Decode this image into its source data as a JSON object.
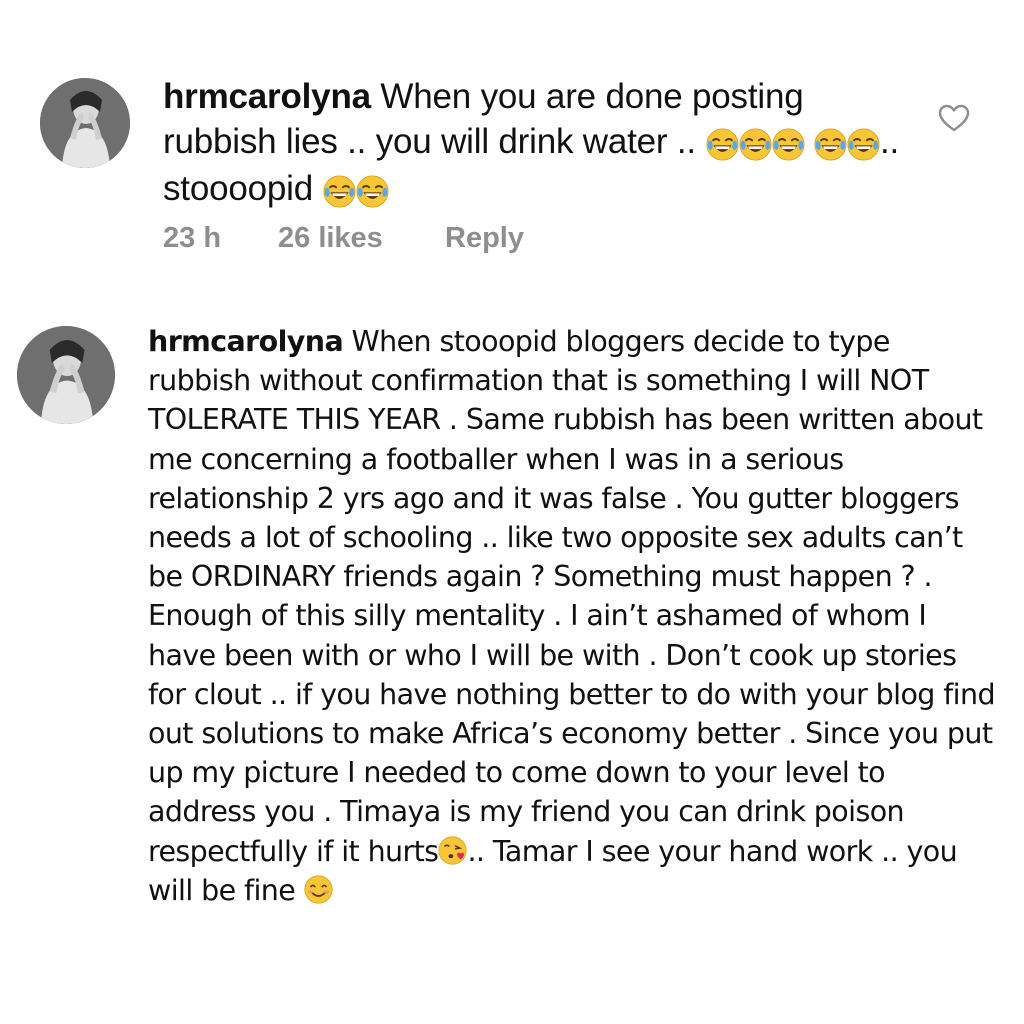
{
  "comments": [
    {
      "username": "hrmcarolyna",
      "text_part1": "When you are done posting rubbish lies .. you will drink water ..",
      "text_part2": ".. stoooopid",
      "emojis_after_part1": [
        "face-with-tears-of-joy",
        "face-with-tears-of-joy",
        "face-with-tears-of-joy"
      ],
      "emojis_before_part2": [
        "face-with-tears-of-joy",
        "face-with-tears-of-joy"
      ],
      "emojis_after_part2": [
        "face-with-tears-of-joy",
        "face-with-tears-of-joy"
      ],
      "time": "23 h",
      "likes": "26 likes",
      "reply_label": "Reply",
      "like_icon": "heart-outline-icon"
    },
    {
      "username": "hrmcarolyna",
      "text_part1": "When stooopid bloggers decide to type rubbish without confirmation that is something I will NOT TOLERATE THIS YEAR . Same rubbish has been written about me concerning a footballer when I was in a serious relationship 2 yrs ago and it was false . You gutter bloggers needs a lot of schooling .. like two opposite sex adults can’t be ORDINARY friends again ? Something must happen ? . Enough of this silly mentality . I ain’t ashamed of whom I have been with or who I will be with . Don’t cook up stories for clout .. if you have nothing better to do with your blog find out solutions to make Africa’s economy better . Since you put up my picture I needed to come down to your level to address you . Timaya is my friend you can drink poison respectfully if it hurts",
      "emoji_mid": "face-blowing-a-kiss",
      "text_part2": ".. Tamar I see your hand work .. you will be fine",
      "emoji_end": "smiling-face-with-smiling-eyes"
    }
  ],
  "watermark": "",
  "colors": {
    "text": "#111111",
    "meta": "#8e8e8e",
    "emoji_yellow": "#f7c637",
    "emoji_tear": "#5aa7e6"
  }
}
